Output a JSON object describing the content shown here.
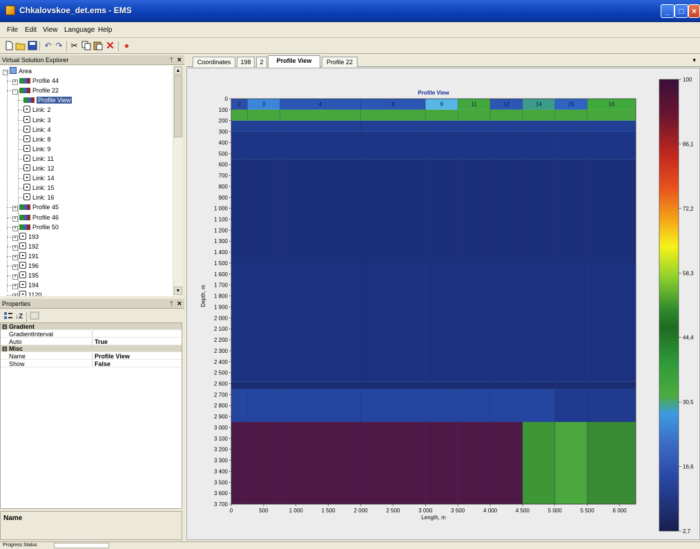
{
  "window": {
    "title": "Chkalovskoe_det.ems - EMS",
    "minimize": "_",
    "maximize": "□",
    "close": "×"
  },
  "menu": [
    "File",
    "Edit",
    "View",
    "Language",
    "Help"
  ],
  "toolbar_icons": [
    "new-file-icon",
    "open-folder-icon",
    "save-icon",
    "undo-icon",
    "redo-icon",
    "cut-icon",
    "copy-icon",
    "paste-icon",
    "delete-icon",
    "record-icon"
  ],
  "explorer": {
    "title": "Virtual Solution Explorer",
    "pin": "ᛘ",
    "close": "×",
    "nodes": [
      {
        "label": "Area",
        "level": 0,
        "icon": "area",
        "expander": "-"
      },
      {
        "label": "Profile 44",
        "level": 1,
        "icon": "prof",
        "expander": "+"
      },
      {
        "label": "Profile 22",
        "level": 1,
        "icon": "prof",
        "expander": "-"
      },
      {
        "label": "Profile View",
        "level": 2,
        "icon": "prof",
        "expander": "",
        "selected": true
      },
      {
        "label": "Link: 2",
        "level": 2,
        "icon": "link",
        "expander": ""
      },
      {
        "label": "Link: 3",
        "level": 2,
        "icon": "link",
        "expander": ""
      },
      {
        "label": "Link: 4",
        "level": 2,
        "icon": "link",
        "expander": ""
      },
      {
        "label": "Link: 8",
        "level": 2,
        "icon": "link",
        "expander": ""
      },
      {
        "label": "Link: 9",
        "level": 2,
        "icon": "link",
        "expander": ""
      },
      {
        "label": "Link: 11",
        "level": 2,
        "icon": "link",
        "expander": ""
      },
      {
        "label": "Link: 12",
        "level": 2,
        "icon": "link",
        "expander": ""
      },
      {
        "label": "Link: 14",
        "level": 2,
        "icon": "link",
        "expander": ""
      },
      {
        "label": "Link: 15",
        "level": 2,
        "icon": "link",
        "expander": ""
      },
      {
        "label": "Link: 16",
        "level": 2,
        "icon": "link",
        "expander": ""
      },
      {
        "label": "Profile 45",
        "level": 1,
        "icon": "prof",
        "expander": "+"
      },
      {
        "label": "Profile 46",
        "level": 1,
        "icon": "prof",
        "expander": "+"
      },
      {
        "label": "Profile 50",
        "level": 1,
        "icon": "prof",
        "expander": "+"
      },
      {
        "label": "193",
        "level": 1,
        "icon": "link",
        "expander": "+"
      },
      {
        "label": "192",
        "level": 1,
        "icon": "link",
        "expander": "+"
      },
      {
        "label": "191",
        "level": 1,
        "icon": "link",
        "expander": "+"
      },
      {
        "label": "196",
        "level": 1,
        "icon": "link",
        "expander": "+"
      },
      {
        "label": "195",
        "level": 1,
        "icon": "link",
        "expander": "+"
      },
      {
        "label": "194",
        "level": 1,
        "icon": "link",
        "expander": "+"
      },
      {
        "label": "1120",
        "level": 1,
        "icon": "link",
        "expander": "+"
      }
    ]
  },
  "properties": {
    "title": "Properties",
    "pin": "ᛘ",
    "close": "×",
    "rows": [
      {
        "type": "cat",
        "name": "Gradient",
        "toggle": "⊟"
      },
      {
        "type": "prop",
        "name": "GradientInterval",
        "value": ""
      },
      {
        "type": "prop",
        "name": "Auto",
        "value": "True"
      },
      {
        "type": "cat",
        "name": "Misc",
        "toggle": "⊟"
      },
      {
        "type": "prop",
        "name": "Name",
        "value": "Profile View"
      },
      {
        "type": "prop",
        "name": "Show",
        "value": "False"
      }
    ],
    "description_title": "Name"
  },
  "status": {
    "label": "Progress Status"
  },
  "tabs": [
    {
      "label": "Coordinates",
      "active": false
    },
    {
      "label": "198",
      "active": false
    },
    {
      "label": "2",
      "active": false
    },
    {
      "label": "Profile View",
      "active": true
    },
    {
      "label": "Profile 22",
      "active": false
    }
  ],
  "tab_menu_arrow": "▾",
  "chart_data": {
    "type": "heatmap",
    "title": "Profile View",
    "xlabel": "Length, m",
    "ylabel": "Depth, m",
    "xlim": [
      0,
      6250
    ],
    "ylim": [
      3700,
      0
    ],
    "x_ticks": [
      "0",
      "500",
      "1 000",
      "1 500",
      "2 000",
      "2 500",
      "3 000",
      "3 500",
      "4 000",
      "4 500",
      "5 000",
      "5 500",
      "6 000"
    ],
    "y_ticks": [
      "0",
      "100",
      "200",
      "300",
      "400",
      "500",
      "600",
      "700",
      "800",
      "900",
      "1 000",
      "1 100",
      "1 200",
      "1 300",
      "1 400",
      "1 500",
      "1 600",
      "1 700",
      "1 800",
      "1 900",
      "2 000",
      "2 100",
      "2 200",
      "2 300",
      "2 400",
      "2 500",
      "2 600",
      "2 700",
      "2 800",
      "2 900",
      "3 000",
      "3 100",
      "3 200",
      "3 300",
      "3 400",
      "3 500",
      "3 600",
      "3 700"
    ],
    "columns": [
      {
        "label": "2",
        "x_start": 0,
        "x_end": 250,
        "header_color": "#2a4fa8"
      },
      {
        "label": "3",
        "x_start": 250,
        "x_end": 750,
        "header_color": "#3c86da"
      },
      {
        "label": "4",
        "x_start": 750,
        "x_end": 2000,
        "header_color": "#2c56b4"
      },
      {
        "label": "8",
        "x_start": 2000,
        "x_end": 3000,
        "header_color": "#2c56b4"
      },
      {
        "label": "9",
        "x_start": 3000,
        "x_end": 3500,
        "header_color": "#58b6e6"
      },
      {
        "label": "11",
        "x_start": 3500,
        "x_end": 4000,
        "header_color": "#42a83e"
      },
      {
        "label": "12",
        "x_start": 4000,
        "x_end": 4500,
        "header_color": "#2c56b4"
      },
      {
        "label": "14",
        "x_start": 4500,
        "x_end": 5000,
        "header_color": "#3d9b89"
      },
      {
        "label": "15",
        "x_start": 5000,
        "x_end": 5500,
        "header_color": "#2f63c4"
      },
      {
        "label": "16",
        "x_start": 5500,
        "x_end": 6250,
        "header_color": "#3faa3b"
      }
    ],
    "layers": [
      {
        "from": 0,
        "to": 100,
        "color": "header"
      },
      {
        "from": 100,
        "to": 200,
        "color": "#46a83c"
      },
      {
        "from": 200,
        "to": 300,
        "color": "#223f96"
      },
      {
        "from": 300,
        "to": 550,
        "color": "#1d3586"
      },
      {
        "from": 550,
        "to": 1500,
        "color": "#1b2f7a"
      },
      {
        "from": 1500,
        "to": 2580,
        "color": "#1c3280"
      },
      {
        "from": 2580,
        "to": 2650,
        "color": "#1a2d72"
      },
      {
        "from": 2650,
        "to": 2950,
        "color": "#2446a0"
      },
      {
        "from": 2950,
        "to": 3700,
        "color": "#4e1947"
      }
    ],
    "right_block": [
      {
        "x_start": 4500,
        "x_end": 5000,
        "from": 2950,
        "to": 3700,
        "color": "#3f9637"
      },
      {
        "x_start": 5000,
        "x_end": 5500,
        "from": 2950,
        "to": 3700,
        "color": "#4aa83e"
      },
      {
        "x_start": 5500,
        "x_end": 6250,
        "from": 2950,
        "to": 3700,
        "color": "#3a8a34"
      },
      {
        "x_start": 5000,
        "x_end": 6250,
        "from": 2650,
        "to": 2950,
        "color": "#1f3a8e"
      }
    ],
    "colorbar": {
      "ticks": [
        "100",
        "86,1",
        "72,2",
        "58,3",
        "44,4",
        "30,5",
        "16,6",
        "2,7"
      ],
      "values": [
        100,
        86.1,
        72.2,
        58.3,
        44.4,
        30.5,
        16.6,
        2.7
      ],
      "range": [
        2.7,
        100
      ]
    }
  }
}
